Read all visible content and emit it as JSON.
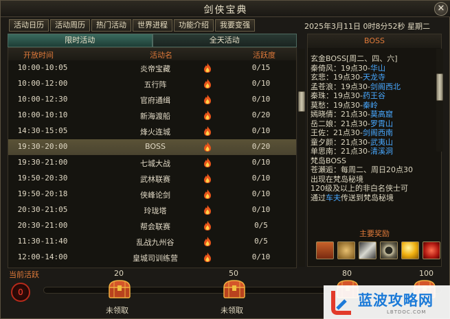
{
  "window": {
    "title": "剑侠宝典",
    "close": "✕"
  },
  "tabs": [
    "活动日历",
    "活动周历",
    "热门活动",
    "世界进程",
    "功能介绍",
    "我要变强"
  ],
  "datetime": "2025年3月11日 0时8分52秒 星期二",
  "subtabs": [
    "限时活动",
    "全天活动"
  ],
  "table": {
    "headers": [
      "开放时间",
      "活动名",
      "活跃度"
    ],
    "rows": [
      {
        "time": "10:00-10:05",
        "name": "炎帝宝藏",
        "value": "0/15"
      },
      {
        "time": "10:00-12:00",
        "name": "五行阵",
        "value": "0/10"
      },
      {
        "time": "10:00-12:30",
        "name": "官府通缉",
        "value": "0/10"
      },
      {
        "time": "10:00-10:10",
        "name": "新海渡船",
        "value": "0/20"
      },
      {
        "time": "14:30-15:05",
        "name": "烽火连城",
        "value": "0/10"
      },
      {
        "time": "19:30-20:00",
        "name": "BOSS",
        "value": "0/20"
      },
      {
        "time": "19:30-21:00",
        "name": "七城大战",
        "value": "0/10"
      },
      {
        "time": "19:50-20:30",
        "name": "武林联赛",
        "value": "0/10"
      },
      {
        "time": "19:50-20:18",
        "name": "侠峰论剑",
        "value": "0/10"
      },
      {
        "time": "20:30-21:05",
        "name": "玲珑塔",
        "value": "0/10"
      },
      {
        "time": "20:30-21:00",
        "name": "帮会联赛",
        "value": "0/5"
      },
      {
        "time": "11:30-11:40",
        "name": "乱战九州谷",
        "value": "0/5"
      },
      {
        "time": "12:00-14:00",
        "name": "皇城司训练营",
        "value": "0/10"
      }
    ],
    "selected_index": 5
  },
  "panel": {
    "title": "BOSS",
    "lines": [
      {
        "text": "玄金BOSS[周二、四、六]",
        "link": ""
      },
      {
        "text": "秦倚风：19点30-",
        "link": "华山"
      },
      {
        "text": "玄悲：19点30-",
        "link": "天龙寺"
      },
      {
        "text": "孟苍浪：19点30-",
        "link": "剑阁西北"
      },
      {
        "text": "秦珠：19点30-",
        "link": "药王谷"
      },
      {
        "text": "莫愁：19点30-",
        "link": "秦岭"
      },
      {
        "text": "嫣晓倩：21点30-",
        "link": "莫高窟"
      },
      {
        "text": "岳二娘：21点30-",
        "link": "罗霄山"
      },
      {
        "text": "王佐：21点30-",
        "link": "剑阁西南"
      },
      {
        "text": "童夕颜：21点30-",
        "link": "武夷山"
      },
      {
        "text": "单思南：21点30-",
        "link": "清溪洞"
      },
      {
        "text": "梵岛BOSS",
        "link": ""
      },
      {
        "text": "苍瀬逅：每周二、周日20点30",
        "link": ""
      },
      {
        "text": "出现在梵岛秘境",
        "link": ""
      },
      {
        "text": "120级及以上的非白名侠士可",
        "link": ""
      },
      {
        "text": "通过",
        "link": "车夫",
        "after": "传送到梵岛秘境"
      }
    ],
    "rewards_title": "主要奖励",
    "rewards": [
      "chest-icon",
      "pouch-icon",
      "sword-icon",
      "ring-icon",
      "gold-orb-icon",
      "red-gem-icon"
    ]
  },
  "progress": {
    "label": "当前活跃",
    "current": "0",
    "fraction": 0.0,
    "milestones": [
      {
        "value": "20",
        "status": "未领取"
      },
      {
        "value": "50",
        "status": "未领取"
      },
      {
        "value": "80",
        "status": ""
      },
      {
        "value": "100",
        "status": ""
      }
    ]
  },
  "watermark": {
    "text": "蓝波攻略网",
    "sub": "LBTDOC.COM"
  },
  "colors": {
    "accent_orange": "#e07a3a",
    "link_blue": "#48a8ff",
    "highlight": "#5a5236",
    "active_tab": "#3a6a5e"
  }
}
